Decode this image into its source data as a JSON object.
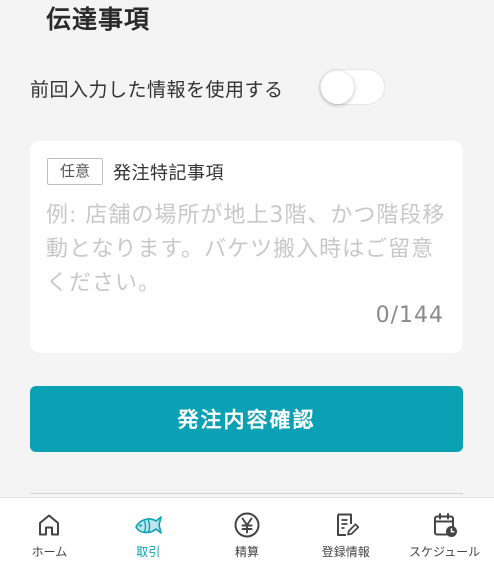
{
  "section": {
    "title": "伝達事項"
  },
  "toggle": {
    "label": "前回入力した情報を使用する",
    "state": "off"
  },
  "note_field": {
    "badge": "任意",
    "label": "発注特記事項",
    "placeholder": "例: 店舗の場所が地上3階、かつ階段移動となります。バケツ搬入時はご留意ください。",
    "value": "",
    "counter": "0/144"
  },
  "confirm_button": {
    "label": "発注内容確認"
  },
  "bottom_nav": {
    "active": "取引",
    "items": [
      {
        "label": "ホーム",
        "icon": "home-icon"
      },
      {
        "label": "取引",
        "icon": "fish-icon"
      },
      {
        "label": "精算",
        "icon": "yen-icon"
      },
      {
        "label": "登録情報",
        "icon": "edit-document-icon"
      },
      {
        "label": "スケジュール",
        "icon": "calendar-clock-icon"
      }
    ]
  },
  "colors": {
    "accent": "#0ba1b5",
    "background": "#f4f4f4",
    "card": "#ffffff",
    "placeholder": "#c8c8c8"
  }
}
